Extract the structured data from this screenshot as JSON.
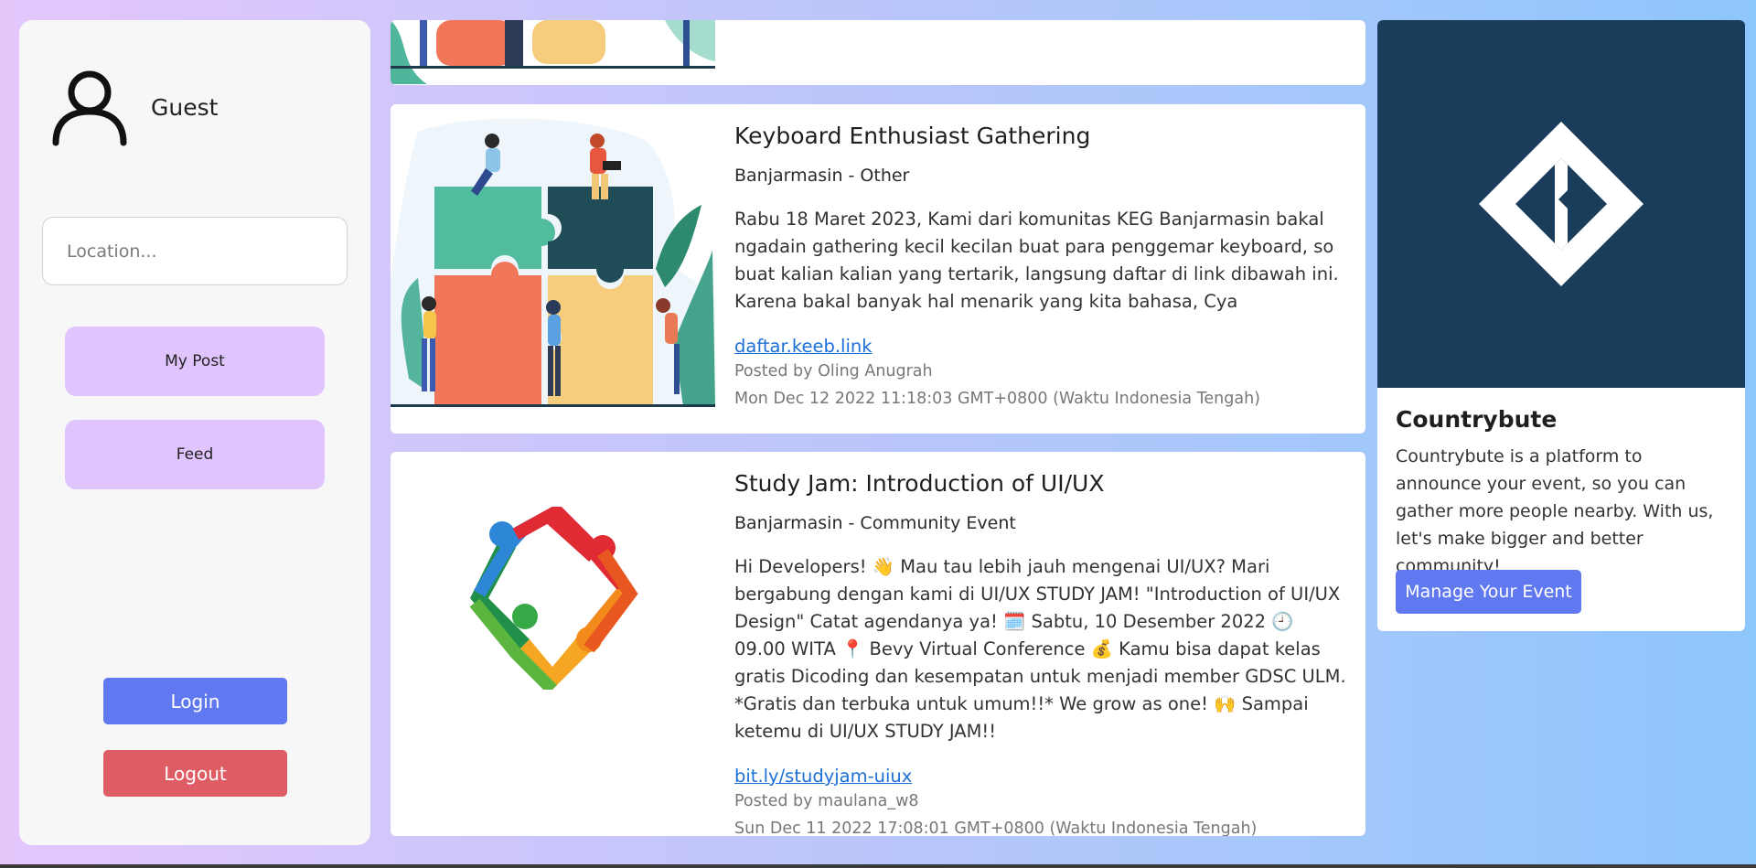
{
  "sidebar": {
    "username": "Guest",
    "location_placeholder": "Location...",
    "nav": {
      "my_post": "My Post",
      "feed": "Feed"
    },
    "login": "Login",
    "logout": "Logout"
  },
  "posts": [
    {
      "title": "Keyboard Enthusiast Gathering",
      "subtitle": "Banjarmasin - Other",
      "description": "Rabu 18 Maret 2023, Kami dari komunitas KEG Banjarmasin bakal ngadain gathering kecil kecilan buat para penggemar keyboard, so buat kalian kalian yang tertarik, langsung daftar di link dibawah ini. Karena bakal banyak hal menarik yang kita bahasa, Cya",
      "link": "daftar.keeb.link",
      "posted_by": "Posted by Oling Anugrah",
      "timestamp": "Mon Dec 12 2022 11:18:03 GMT+0800 (Waktu Indonesia Tengah)"
    },
    {
      "title": "Study Jam: Introduction of UI/UX",
      "subtitle": "Banjarmasin - Community Event",
      "description": "Hi Developers! 👋 Mau tau lebih jauh mengenai UI/UX? Mari bergabung dengan kami di UI/UX STUDY JAM! \"Introduction of UI/UX Design\" Catat agendanya ya! 🗓️ Sabtu, 10 Desember 2022 🕘 09.00 WITA 📍 Bevy Virtual Conference 💰 Kamu bisa dapat kelas gratis Dicoding dan kesempatan untuk menjadi member GDSC ULM. *Gratis dan terbuka untuk umum!!* We grow as one! 🙌 Sampai ketemu di UI/UX STUDY JAM!!",
      "link": "bit.ly/studyjam-uiux",
      "posted_by": "Posted by maulana_w8",
      "timestamp": "Sun Dec 11 2022 17:08:01 GMT+0800 (Waktu Indonesia Tengah)"
    }
  ],
  "info": {
    "title": "Countrybute",
    "description": "Countrybute is a platform to announce your event, so you can gather more people nearby. With us, let's make bigger and better community!",
    "button": "Manage Your Event"
  },
  "colors": {
    "primary": "#6079f0",
    "danger": "#de5c63",
    "nav": "#e0c4fd",
    "brand_dark": "#1a3d5c"
  }
}
